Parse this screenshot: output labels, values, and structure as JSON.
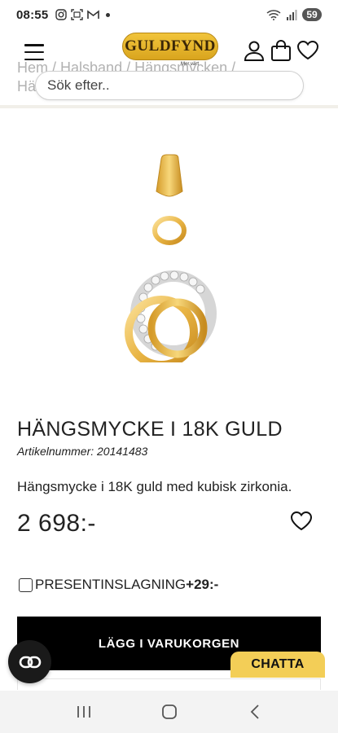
{
  "status_bar": {
    "time": "08:55",
    "battery": "59",
    "icons": [
      "instagram-icon",
      "scan-icon",
      "gmail-icon",
      "notification-dot",
      "wifi-icon",
      "signal-icon",
      "battery-icon"
    ]
  },
  "header": {
    "logo_text": "GULDFYND",
    "logo_tagline": "Mer värt",
    "icons": [
      "menu-icon",
      "account-icon",
      "cart-icon",
      "wishlist-heart-icon"
    ]
  },
  "breadcrumb": {
    "items": [
      "Hem",
      "Halsband",
      "Hängsmycken"
    ],
    "separator": "/",
    "line2": "Hä"
  },
  "search": {
    "placeholder": "Sök efter.."
  },
  "product": {
    "title": "HÄNGSMYCKE I 18K GULD",
    "article_label": "Artikelnummer: 20141483",
    "description": "Hängsmycke i 18K guld med kubisk zirkonia.",
    "price": "2 698:-"
  },
  "gift_wrap": {
    "label": "PRESENTINSLAGNING",
    "price": "+29:-",
    "checked": false
  },
  "buttons": {
    "add_to_cart": "LÄGG I VARUKORGEN",
    "chat": "CHATTA"
  },
  "colors": {
    "brand_gold": "#f1c43b",
    "chat_yellow": "#f3ce57",
    "cta_black": "#000000"
  }
}
